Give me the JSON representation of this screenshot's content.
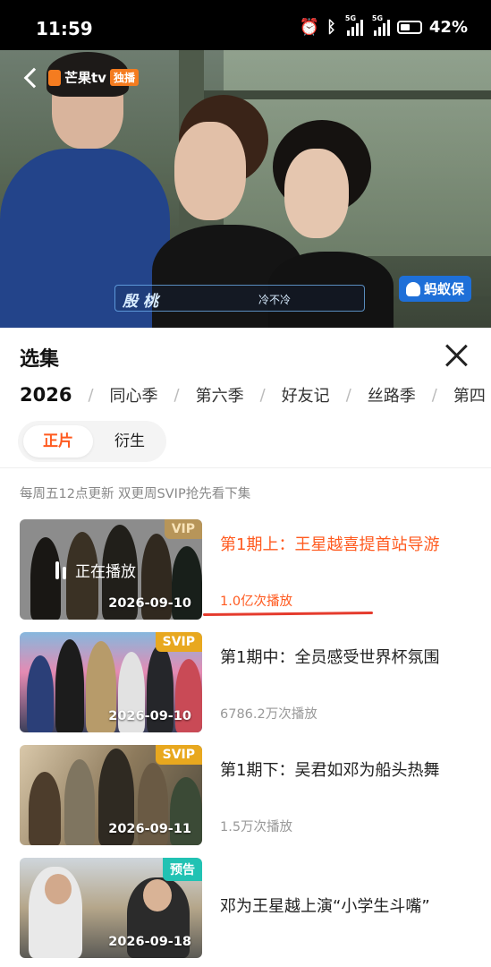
{
  "status_bar": {
    "time": "11:59",
    "network1": "5G",
    "network2": "5G",
    "battery": "42%"
  },
  "video": {
    "logo_text": "芒果tv",
    "exclusive_badge": "独播",
    "subtitle_name": "殷 桃",
    "subtitle_text": "冷不冷",
    "ad_text": "蚂蚁保"
  },
  "panel": {
    "title": "选集",
    "seasons": [
      {
        "label": "2026",
        "active": true
      },
      {
        "label": "同心季"
      },
      {
        "label": "第六季"
      },
      {
        "label": "好友记"
      },
      {
        "label": "丝路季"
      },
      {
        "label": "第四"
      }
    ],
    "tabs": [
      {
        "label": "正片"
      },
      {
        "label": "衍生"
      }
    ],
    "notice": "每周五12点更新 双更周SVIP抢先看下集",
    "playing_label": "正在播放",
    "episodes": [
      {
        "title": "第1期上：王星越喜提首站导游",
        "views": "1.0亿次播放",
        "date": "2026-09-10",
        "badge": "VIP"
      },
      {
        "title": "第1期中：全员感受世界杯氛围",
        "views": "6786.2万次播放",
        "date": "2026-09-10",
        "badge": "SVIP"
      },
      {
        "title": "第1期下：吴君如邓为船头热舞",
        "views": "1.5万次播放",
        "date": "2026-09-11",
        "badge": "SVIP"
      },
      {
        "title": "邓为王星越上演“小学生斗嘴”",
        "views": "",
        "date": "2026-09-18",
        "badge": "预告"
      }
    ]
  },
  "colors": {
    "accent": "#ff5a1f",
    "svip": "#e8a81f",
    "preview": "#21c2b3",
    "underline": "#e53b2d"
  }
}
